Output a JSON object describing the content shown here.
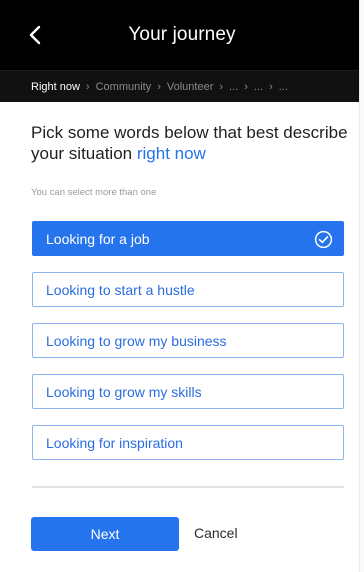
{
  "header": {
    "title": "Your journey",
    "back_icon": "chevron-left-icon"
  },
  "breadcrumb": {
    "items": [
      "Right now",
      "Community",
      "Volunteer",
      "...",
      "...",
      "..."
    ],
    "active_index": 0
  },
  "main": {
    "heading_prefix": "Pick some words below that best describe your situation",
    "heading_accent": "right now",
    "hint": "You can select more than one",
    "options": [
      {
        "label": "Looking for a job",
        "selected": true
      },
      {
        "label": "Looking to start a hustle",
        "selected": false
      },
      {
        "label": "Looking to grow my business",
        "selected": false
      },
      {
        "label": "Looking to grow my skills",
        "selected": false
      },
      {
        "label": "Looking for inspiration",
        "selected": false
      }
    ]
  },
  "footer": {
    "next_label": "Next",
    "cancel_label": "Cancel"
  },
  "colors": {
    "accent": "#2573ed",
    "header_bg": "#000000",
    "breadcrumb_bg": "#111111"
  }
}
